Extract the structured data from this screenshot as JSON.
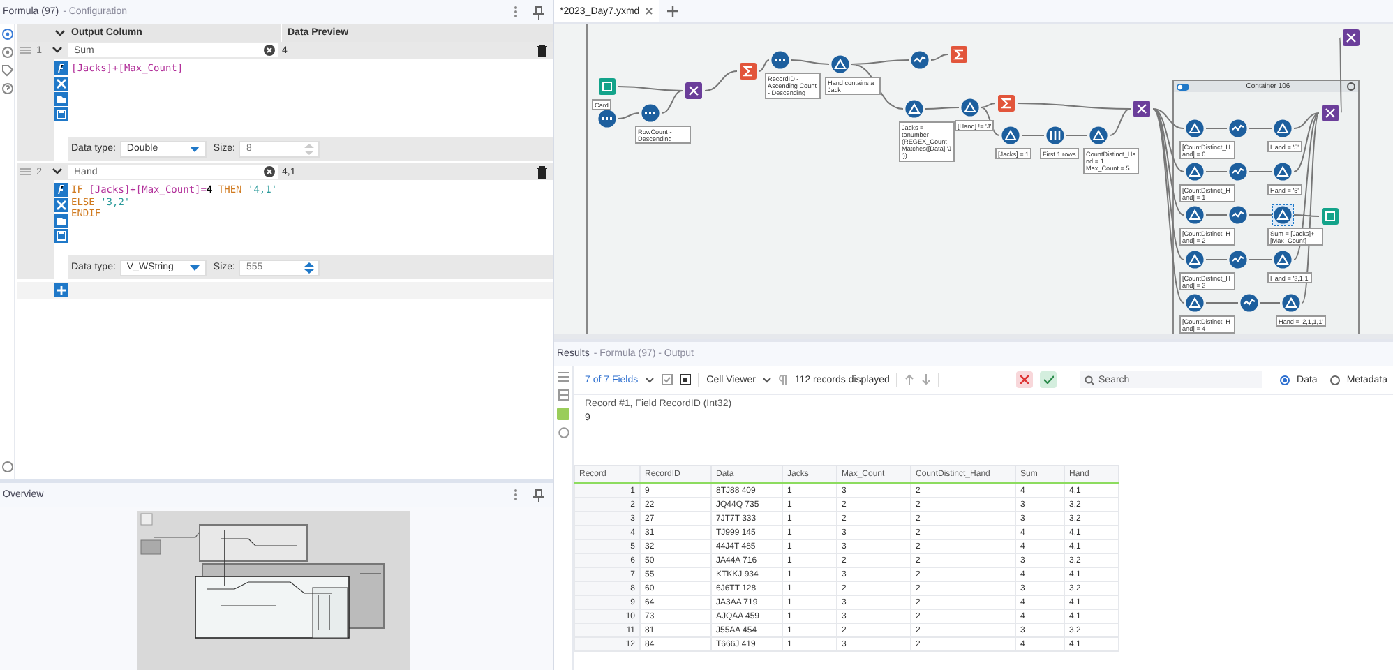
{
  "config": {
    "title": "Formula (97)",
    "subtitle": "- Configuration",
    "columns": [
      "Output Column",
      "Data Preview"
    ],
    "formulas": [
      {
        "index": "1",
        "name": "Sum",
        "preview": "4",
        "lines": [
          [
            {
              "text": "[Jacks]",
              "kind": "field"
            },
            {
              "text": "+",
              "kind": "op"
            },
            {
              "text": "[Max_Count]",
              "kind": "field"
            }
          ]
        ],
        "type_label": "Data type:",
        "type": "Double",
        "size_label": "Size:",
        "size": "8",
        "size_enabled": false
      },
      {
        "index": "2",
        "name": "Hand",
        "preview": "4,1",
        "lines": [
          [
            {
              "text": "IF ",
              "kind": "keyword"
            },
            {
              "text": "[Jacks]",
              "kind": "field"
            },
            {
              "text": "+",
              "kind": "op"
            },
            {
              "text": "[Max_Count]",
              "kind": "field"
            },
            {
              "text": "=",
              "kind": "op"
            },
            {
              "text": "4",
              "kind": "number"
            },
            {
              "text": " THEN ",
              "kind": "keyword"
            },
            {
              "text": "'4,1'",
              "kind": "string"
            }
          ],
          [
            {
              "text": "ELSE ",
              "kind": "keyword"
            },
            {
              "text": "'3,2'",
              "kind": "string"
            }
          ],
          [
            {
              "text": "ENDIF",
              "kind": "keyword"
            }
          ]
        ],
        "type_label": "Data type:",
        "type": "V_WString",
        "size_label": "Size:",
        "size": "555",
        "size_enabled": true
      }
    ]
  },
  "overview": {
    "title": "Overview"
  },
  "tabs": [
    {
      "label": "*2023_Day7.yxmd",
      "selected": true
    }
  ],
  "canvas": {
    "container": {
      "title": "Container 106"
    },
    "nodes": [
      {
        "kind": "book",
        "label": "Card",
        "selected": false
      },
      {
        "kind": "input",
        "selected": false
      },
      {
        "kind": "sort",
        "label": "RowCount - Descending",
        "selected": false
      },
      {
        "kind": "join",
        "selected": false
      },
      {
        "kind": "summarize",
        "selected": false
      },
      {
        "kind": "sort",
        "label": "RecordID - Ascending Count - Descending",
        "selected": false
      },
      {
        "kind": "filter",
        "label": "Hand contains a Jack",
        "selected": false
      },
      {
        "kind": "multirow",
        "selected": false
      },
      {
        "kind": "summarize",
        "selected": false
      },
      {
        "kind": "formula",
        "label": "Jacks = tonumber (REGEX_CountMatches([Data],'J'))",
        "selected": false
      },
      {
        "kind": "filter",
        "label": "[Hand] != 'J'",
        "selected": false
      },
      {
        "kind": "summarize",
        "selected": false
      },
      {
        "kind": "filter",
        "label": "[Jacks] = 1",
        "selected": false
      },
      {
        "kind": "sample",
        "label": "First 1 rows",
        "selected": false
      },
      {
        "kind": "formula",
        "label": "CountDistinct_Hand = 1 Max_Count = 5",
        "selected": false
      },
      {
        "kind": "union",
        "selected": false
      },
      {
        "kind": "filter",
        "label": "[CountDistinct_Hand] = 0",
        "selected": false
      },
      {
        "kind": "filter",
        "label": "[CountDistinct_Hand] = 1",
        "selected": false
      },
      {
        "kind": "filter",
        "label": "[CountDistinct_Hand] = 2",
        "selected": false
      },
      {
        "kind": "filter",
        "label": "[CountDistinct_Hand] = 3",
        "selected": false
      },
      {
        "kind": "filter",
        "label": "[CountDistinct_Hand] = 4",
        "selected": false
      },
      {
        "kind": "multirow",
        "selected": false
      },
      {
        "kind": "multirow",
        "selected": false
      },
      {
        "kind": "multirow",
        "selected": false
      },
      {
        "kind": "multirow",
        "selected": false
      },
      {
        "kind": "multirow",
        "selected": false
      },
      {
        "kind": "formula",
        "label": "Hand = '5'",
        "selected": false
      },
      {
        "kind": "formula",
        "label": "Hand = '5'",
        "selected": false
      },
      {
        "kind": "formula",
        "label": "Sum = [Jacks]+ [Max_Count]",
        "selected": true
      },
      {
        "kind": "formula",
        "label": "Hand = '3,1,1'",
        "selected": false
      },
      {
        "kind": "formula",
        "label": "Hand = '2,1,1,1'",
        "selected": false
      },
      {
        "kind": "browse",
        "selected": false
      },
      {
        "kind": "union",
        "selected": false
      },
      {
        "kind": "join",
        "selected": false
      }
    ]
  },
  "results": {
    "title": "Results",
    "subtitle": "- Formula (97) - Output",
    "fields": "7 of 7 Fields",
    "viewer": "Cell Viewer",
    "records": "112 records displayed",
    "search": {
      "placeholder": "Search"
    },
    "views": [
      {
        "label": "Data",
        "selected": true
      },
      {
        "label": "Metadata",
        "selected": false
      }
    ],
    "record_info": "Record #1, Field RecordID (Int32)",
    "record_value": "9",
    "table": {
      "columns": [
        "Record",
        "RecordID",
        "Data",
        "Jacks",
        "Max_Count",
        "CountDistinct_Hand",
        "Sum",
        "Hand"
      ],
      "rows": [
        [
          "1",
          "9",
          "8TJ88 409",
          "1",
          "3",
          "2",
          "4",
          "4,1"
        ],
        [
          "2",
          "22",
          "JQ44Q 735",
          "1",
          "2",
          "2",
          "3",
          "3,2"
        ],
        [
          "3",
          "27",
          "7JT7T 333",
          "1",
          "2",
          "2",
          "3",
          "3,2"
        ],
        [
          "4",
          "31",
          "TJ999 145",
          "1",
          "3",
          "2",
          "4",
          "4,1"
        ],
        [
          "5",
          "32",
          "44J4T 485",
          "1",
          "3",
          "2",
          "4",
          "4,1"
        ],
        [
          "6",
          "50",
          "JA44A 716",
          "1",
          "2",
          "2",
          "3",
          "3,2"
        ],
        [
          "7",
          "55",
          "KTKKJ 934",
          "1",
          "3",
          "2",
          "4",
          "4,1"
        ],
        [
          "8",
          "60",
          "6J6TT 128",
          "1",
          "2",
          "2",
          "3",
          "3,2"
        ],
        [
          "9",
          "64",
          "JA3AA 719",
          "1",
          "3",
          "2",
          "4",
          "4,1"
        ],
        [
          "10",
          "73",
          "AJQAA 459",
          "1",
          "3",
          "2",
          "4",
          "4,1"
        ],
        [
          "11",
          "81",
          "J55AA 454",
          "1",
          "2",
          "2",
          "3",
          "3,2"
        ],
        [
          "12",
          "84",
          "T666J 419",
          "1",
          "3",
          "2",
          "4",
          "4,1"
        ]
      ]
    }
  }
}
